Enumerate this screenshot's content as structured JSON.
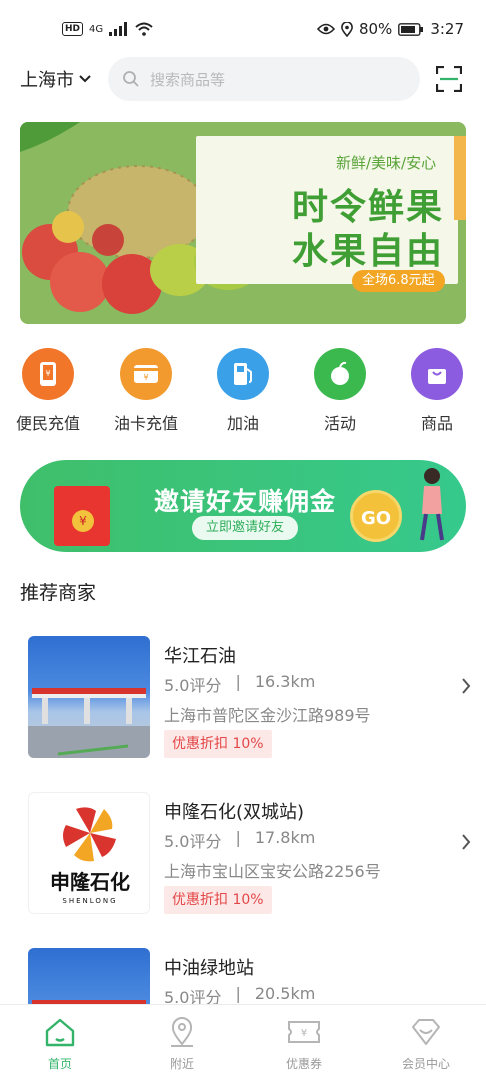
{
  "status_bar": {
    "hd": "HD",
    "network": "4G",
    "battery": "80%",
    "time": "3:27"
  },
  "header": {
    "city": "上海市",
    "search_placeholder": "搜索商品等"
  },
  "banner": {
    "subtitle": "新鲜/美味/安心",
    "title_line1": "时令鲜果",
    "title_line2": "水果自由",
    "pill": "全场6.8元起"
  },
  "quick_actions": [
    {
      "label": "便民充值",
      "icon": "phone-recharge-icon",
      "color": "#f2762a"
    },
    {
      "label": "油卡充值",
      "icon": "card-recharge-icon",
      "color": "#f39a2e"
    },
    {
      "label": "加油",
      "icon": "fuel-pump-icon",
      "color": "#3aa0e8"
    },
    {
      "label": "活动",
      "icon": "apple-icon",
      "color": "#3cb94e"
    },
    {
      "label": "商品",
      "icon": "shopping-bag-icon",
      "color": "#8b5be0"
    }
  ],
  "invite": {
    "title": "邀请好友赚佣金",
    "button": "立即邀请好友",
    "envelope_symbol": "¥",
    "coin_text": "GO"
  },
  "section_title": "推荐商家",
  "merchants": [
    {
      "name": "华江石油",
      "rating": "5.0评分",
      "separator": "|",
      "distance": "16.3km",
      "address": "上海市普陀区金沙江路989号",
      "discount": "优惠折扣 10%"
    },
    {
      "name": "申隆石化(双城站)",
      "rating": "5.0评分",
      "separator": "|",
      "distance": "17.8km",
      "address": "上海市宝山区宝安公路2256号",
      "discount": "优惠折扣 10%",
      "logo_text": "申隆石化",
      "logo_sub": "SHENLONG"
    },
    {
      "name": "中油绿地站",
      "rating": "5.0评分",
      "separator": "|",
      "distance": "20.5km"
    }
  ],
  "tabs": [
    {
      "label": "首页",
      "icon": "home-icon",
      "active": true
    },
    {
      "label": "附近",
      "icon": "location-pin-icon",
      "active": false
    },
    {
      "label": "优惠券",
      "icon": "coupon-icon",
      "active": false
    },
    {
      "label": "会员中心",
      "icon": "diamond-icon",
      "active": false
    }
  ],
  "colors": {
    "brand_green": "#34b46a",
    "discount_red": "#e24848"
  }
}
